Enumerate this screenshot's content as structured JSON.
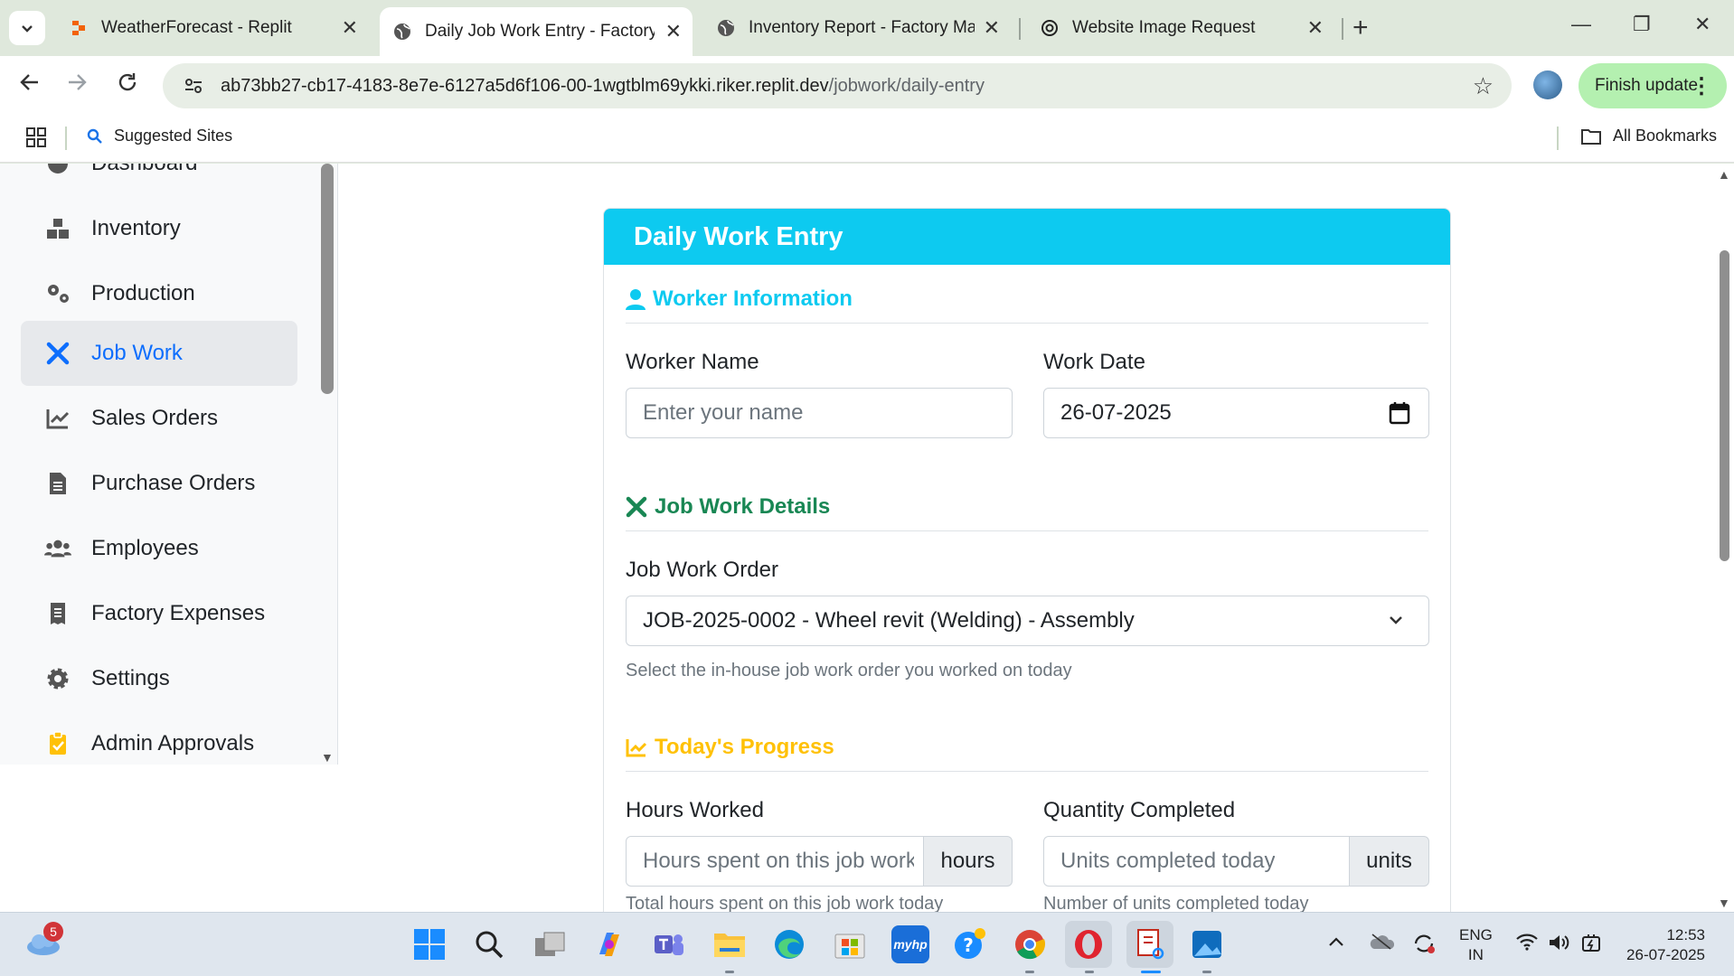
{
  "browser": {
    "tabs": [
      {
        "title": "WeatherForecast - Replit",
        "icon": "replit-icon",
        "active": false
      },
      {
        "title": "Daily Job Work Entry - Factory Management",
        "icon": "globe-icon",
        "active": true
      },
      {
        "title": "Inventory Report - Factory Management",
        "icon": "globe-icon",
        "active": false
      },
      {
        "title": "Website Image Request",
        "icon": "openai-icon",
        "active": false
      }
    ],
    "url_host": "ab73bb27-cb17-4183-8e7e-6127a5d6f106-00-1wgtblm69ykki.riker.replit.dev",
    "url_path": "/jobwork/daily-entry",
    "finish_update_label": "Finish update",
    "bookmarks": {
      "suggested_sites": "Suggested Sites",
      "all_bookmarks": "All Bookmarks"
    }
  },
  "sidebar": {
    "items": [
      {
        "label": "Dashboard",
        "icon": "dashboard-icon",
        "active": false
      },
      {
        "label": "Inventory",
        "icon": "boxes-icon",
        "active": false
      },
      {
        "label": "Production",
        "icon": "gears-icon",
        "active": false
      },
      {
        "label": "Job Work",
        "icon": "tools-icon",
        "active": true
      },
      {
        "label": "Sales Orders",
        "icon": "chart-line-icon",
        "active": false
      },
      {
        "label": "Purchase Orders",
        "icon": "file-invoice-icon",
        "active": false
      },
      {
        "label": "Employees",
        "icon": "users-icon",
        "active": false
      },
      {
        "label": "Factory Expenses",
        "icon": "receipt-icon",
        "active": false
      },
      {
        "label": "Settings",
        "icon": "gear-icon",
        "active": false
      },
      {
        "label": "Admin Approvals",
        "icon": "clipboard-check-icon",
        "active": false
      }
    ]
  },
  "form": {
    "header": "Daily Work Entry",
    "worker_section": {
      "title": "Worker Information",
      "color": "#0dcaf0",
      "worker_name_label": "Worker Name",
      "worker_name_placeholder": "Enter your name",
      "work_date_label": "Work Date",
      "work_date_value": "26-07-2025"
    },
    "job_section": {
      "title": "Job Work Details",
      "color": "#198754",
      "order_label": "Job Work Order",
      "order_value": "JOB-2025-0002 - Wheel revit (Welding) - Assembly",
      "order_help": "Select the in-house job work order you worked on today"
    },
    "progress_section": {
      "title": "Today's Progress",
      "color": "#ffc107",
      "hours_label": "Hours Worked",
      "hours_placeholder": "Hours spent on this job work",
      "hours_unit": "hours",
      "hours_help": "Total hours spent on this job work today",
      "qty_label": "Quantity Completed",
      "qty_placeholder": "Units completed today",
      "qty_unit": "units",
      "qty_help": "Number of units completed today"
    }
  },
  "taskbar": {
    "weather_badge": "5",
    "language": "ENG",
    "region": "IN",
    "time": "12:53",
    "date": "26-07-2025"
  }
}
